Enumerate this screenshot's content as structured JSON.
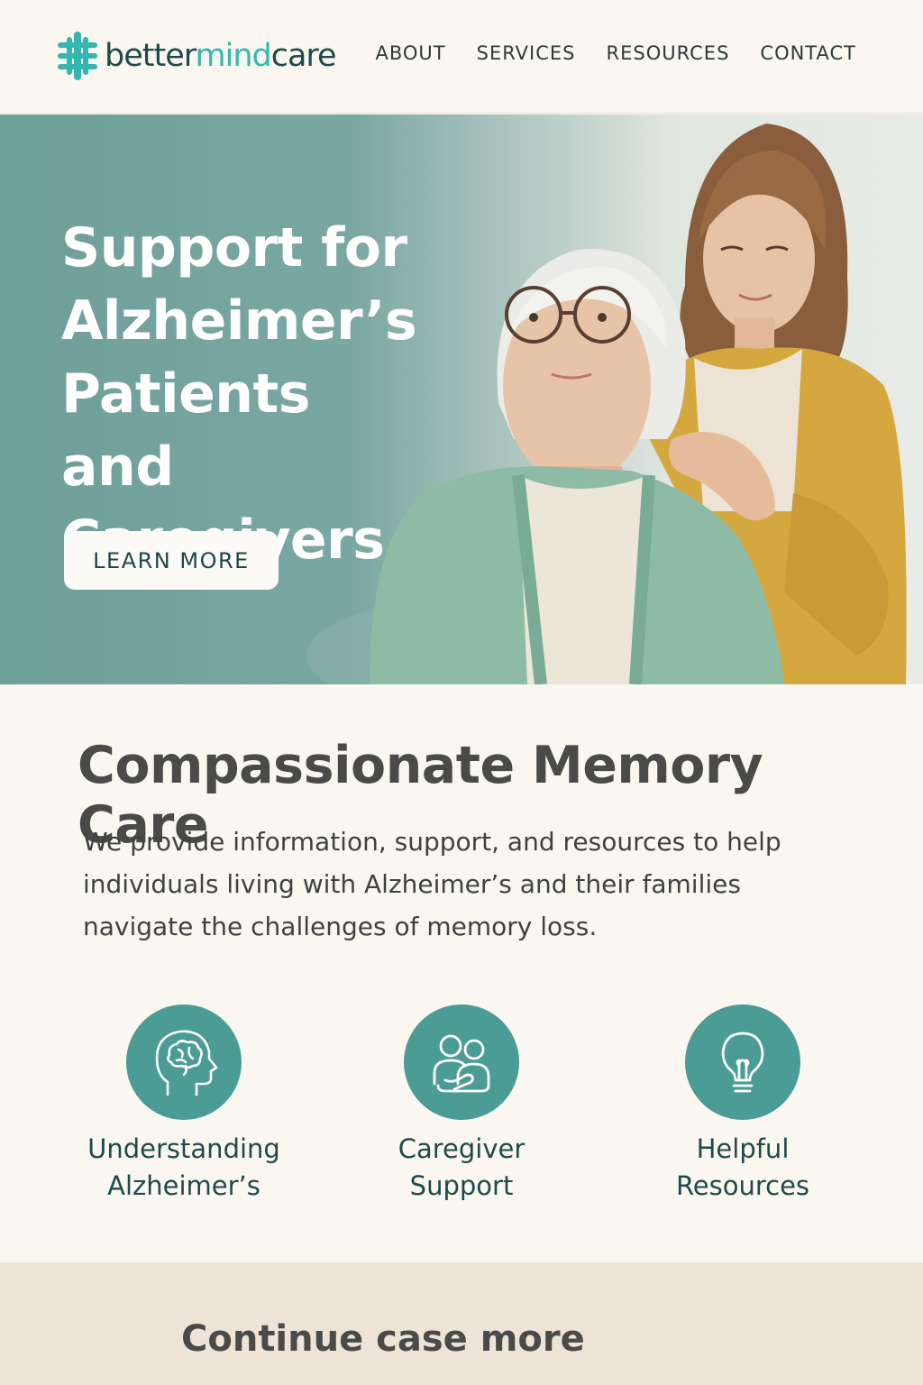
{
  "brand": {
    "name_part1": "better",
    "name_part2": "mind",
    "name_part3": "care",
    "accent_color": "#34b7b0",
    "logo_icon": "cross-plus-logo-icon"
  },
  "nav": {
    "items": [
      {
        "label": "ABOUT"
      },
      {
        "label": "SERVICES"
      },
      {
        "label": "RESOURCES"
      },
      {
        "label": "CONTACT"
      }
    ]
  },
  "hero": {
    "title_lines": [
      "Support for",
      "Alzheimer’s",
      "Patients and",
      "Caregivers"
    ],
    "button_label": "LEARN MORE",
    "image": "photo-elderly-woman-with-caregiver"
  },
  "intro": {
    "title": "Compassionate Memory Care",
    "text": "We provide information, support, and resources to help individuals living with Alzheimer’s and their families navigate the challenges of memory loss."
  },
  "features": [
    {
      "icon": "head-brain-icon",
      "label_lines": [
        "Understanding",
        "Alzheimer’s"
      ]
    },
    {
      "icon": "people-support-icon",
      "label_lines": [
        "Caregiver",
        "Support"
      ]
    },
    {
      "icon": "lightbulb-icon",
      "label_lines": [
        "Helpful",
        "Resources"
      ]
    }
  ],
  "footer_band": {
    "text": "Continue case more"
  },
  "colors": {
    "teal": "#4a9c95",
    "hero_teal": "#7aa7a1",
    "cream": "#faf7f1",
    "sand": "#ede4d7"
  }
}
